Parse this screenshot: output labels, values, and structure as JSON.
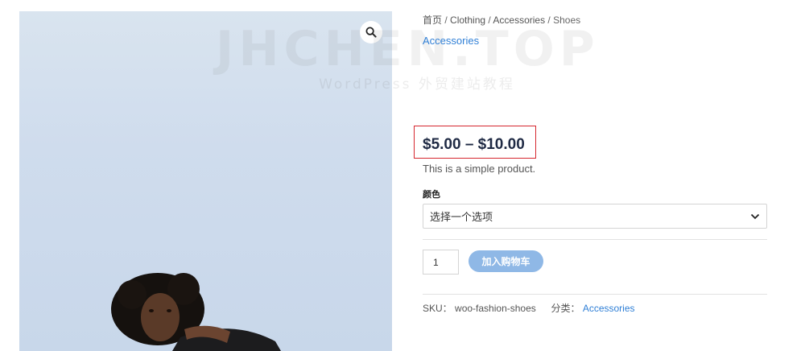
{
  "watermark": {
    "title": "JHCHEN.TOP",
    "subtitle": "WordPress 外贸建站教程"
  },
  "gallery": {
    "zoom_icon": "search-icon",
    "background": "#cfdced"
  },
  "breadcrumb": {
    "home": "首页",
    "sep1": " / ",
    "clothing": "Clothing",
    "sep2": " / ",
    "accessories": "Accessories",
    "sep3": " / ",
    "current": "Shoes"
  },
  "product": {
    "category_link": "Accessories",
    "price": "$5.00 – $10.00",
    "short_description": "This is a simple product.",
    "attribute_label": "颜色",
    "select_placeholder": "选择一个选项",
    "quantity": "1",
    "add_to_cart": "加入购物车",
    "highlight_color": "#d6262e",
    "accent_color": "#2f7fd6"
  },
  "meta": {
    "sku_label": "SKU：",
    "sku_value": "woo-fashion-shoes",
    "category_label": "分类：",
    "category_value": "Accessories"
  }
}
